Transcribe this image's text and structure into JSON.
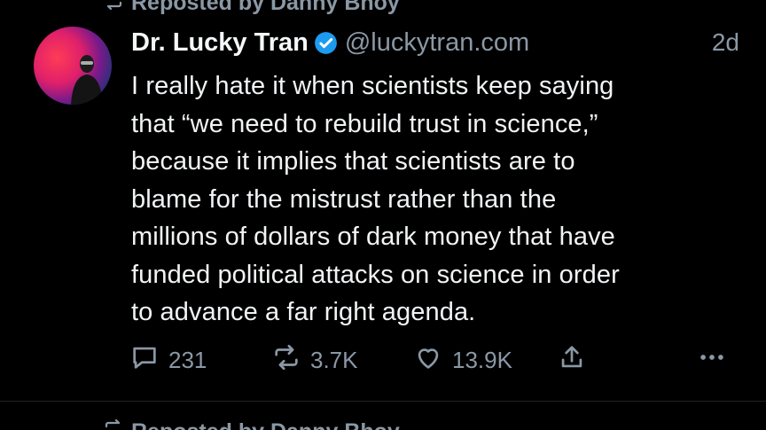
{
  "repost": {
    "label_top": "Reposted by Danny Bhoy",
    "label_bottom": "Reposted by Danny Bhoy"
  },
  "post": {
    "display_name": "Dr. Lucky Tran",
    "handle": "@luckytran.com",
    "timestamp": "2d",
    "verified": true,
    "text_lines": [
      "I really hate it when scientists keep saying",
      "that “we need to rebuild trust in science,”",
      "because it implies that scientists are to",
      "blame for the mistrust rather than the",
      "millions of dollars of dark money that have",
      "funded political attacks on science in order",
      "to advance a far right agenda."
    ],
    "actions": {
      "reply_count": "231",
      "repost_count": "3.7K",
      "like_count": "13.9K"
    }
  },
  "colors": {
    "background": "#000000",
    "primary_text": "#f1f3f5",
    "secondary_text": "#8b98a5",
    "verified_blue": "#1d9bf0"
  },
  "icons": [
    "repost-icon",
    "verified-badge-icon",
    "reply-icon",
    "like-icon",
    "share-icon",
    "more-icon"
  ]
}
